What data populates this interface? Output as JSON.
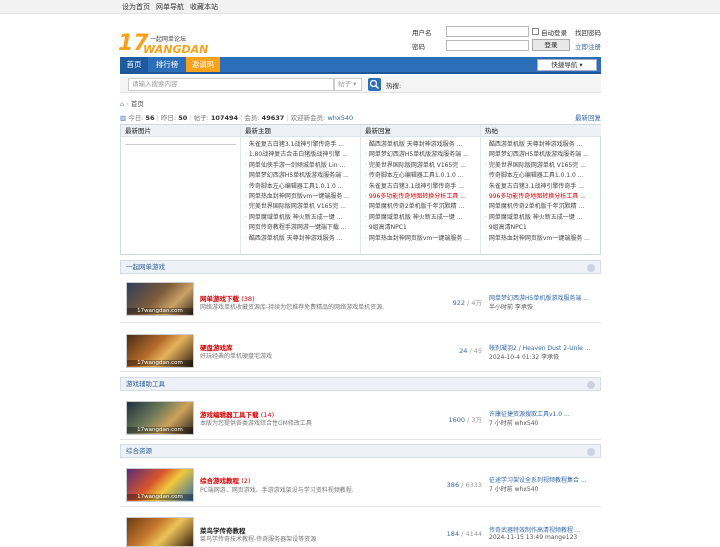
{
  "topbar": {
    "links": [
      "设为首页",
      "网单导航",
      "收藏本站"
    ]
  },
  "logo": {
    "big": "17",
    "word": "WANGDAN",
    "slogan": "一起网单论坛"
  },
  "login": {
    "username_label": "用户名",
    "password_label": "密码",
    "auto_login": "自动登录",
    "forgot": "找回密码",
    "login_button": "登录",
    "register": "立即注册"
  },
  "nav": {
    "home": "首页",
    "ranking": "排行榜",
    "invite": "邀请码",
    "quick_nav": "快捷导航"
  },
  "search": {
    "placeholder": "请输入搜索内容",
    "type": "帖子",
    "hot_label": "热搜:"
  },
  "breadcrumb": {
    "home": "首页"
  },
  "stats": {
    "today_label": "今日:",
    "today": "56",
    "yesterday_label": "昨日:",
    "yesterday": "50",
    "posts_label": "帖子:",
    "posts": "107494",
    "members_label": "会员:",
    "members": "49637",
    "newest_label": "欢迎新会员:",
    "newest": "whx540",
    "latest_reply": "最新回复"
  },
  "portal": {
    "col1_title": "最新图片",
    "col2_title": "最新主题",
    "col3_title": "最新回复",
    "col4_title": "热帖",
    "col2": [
      "朱雀复古白猪3.1战神引擎传奇手 ...",
      "1.80战神复古合击白猪版战神引擎 ...",
      "网单仙侠手游一剑倾城单机版 Lin ...",
      "网单梦幻西游H5单机版游戏服务端 ...",
      "传奇脚本左心编辑器工具1.0.1.0 ...",
      "网单热血封神网页版vm一键端服务 ...",
      "完美世界国际版网游单机 V165完 ...",
      "网单魔域单机版 神火新五成一键 ...",
      "网页传奇教程手游网游一键端下载 ...",
      "酷西游单机版 天尊封神游戏服务 ..."
    ],
    "col3": [
      "酷西游单机版 天尊封神游戏服务 ...",
      "网单梦幻西游H5单机版游戏服务端 ...",
      "完美世界国际版网游单机 V165完 ...",
      "传奇脚本左心编辑器工具1.0.1.0 ...",
      "朱雀复古白猪3.1战神引擎传奇手 ...",
      "996多功能传奇地图转换分析工具 ...",
      "网单魔机传奇2单机版千年沉默精 ...",
      "网单魔域单机版 神火新五成一键 ...",
      "9组高清NPC1",
      "网单热血封神网页版vm一键端服务 ..."
    ],
    "col4": [
      "酷西游单机版 天尊封神游戏服务 ...",
      "网单梦幻西游H5单机版游戏服务端 ...",
      "完美世界国际版网游单机 V165完 ...",
      "传奇脚本左心编辑器工具1.0.1.0 ...",
      "朱雀复古白猪3.1战神引擎传奇手 ...",
      "996多功能传奇地图转换分析工具 ...",
      "网单魔机传奇2单机版千年沉默精 ...",
      "网单魔域单机版 神火新五成一键 ...",
      "9组高清NPC1",
      "网单热血封神网页版vm一键端服务 ..."
    ]
  },
  "sections": [
    {
      "title": "一起网单游戏"
    },
    {
      "title": "游戏辅助工具"
    },
    {
      "title": "综合资源"
    }
  ],
  "forums": [
    {
      "name": "网单游戏下载",
      "count": "(38)",
      "desc": "网络游戏单机收藏资源库-持续为您推荐免费精品的网络游戏单机资源.",
      "threads": "922",
      "posts": "4万",
      "last": "网单梦幻西游H5单机版游戏服务端 ...",
      "last_meta": "半小时前 李承恢",
      "thumb": "17wangdan.com"
    },
    {
      "name": "硬盘游戏库",
      "count": "",
      "desc": "好玩经典的单机硬盘宅游戏",
      "threads": "24",
      "posts": "45",
      "last": "帐别凝羽2 / Heaven Dust 2-Unle ...",
      "last_meta": "2024-10-4 01:32 李承恢",
      "thumb": "17wangdan.com"
    },
    {
      "name": "游戏编辑器工具下载",
      "count": "(14)",
      "desc": "本版为您提供各类游戏综合性GM修改工具",
      "threads": "1600",
      "posts": "3万",
      "last": "许康征捷资源搜取工具v1.0 ...",
      "last_meta": "7 小时前 whx540",
      "thumb": "17wangdan.com"
    },
    {
      "name": "综合游戏教程",
      "count": "(2)",
      "desc": "PC端网游、网页游戏、手游游戏架设与学习资料视频教程.",
      "threads": "386",
      "posts": "6333",
      "last": "征途学习架设全系列视频教程集合 ...",
      "last_meta": "7 小时前 whx540",
      "thumb": "17wangdan.com"
    },
    {
      "name": "菜鸟学传奇教程",
      "count": "",
      "desc": "菜鸟学传奇技术教程-传奇服务器架设等资源",
      "threads": "184",
      "posts": "4144",
      "last": "传奇武器特效制作高清视频教程 ...",
      "last_meta": "2024-11-15 13:49 mange123",
      "thumb": "17wangdan.com"
    }
  ]
}
